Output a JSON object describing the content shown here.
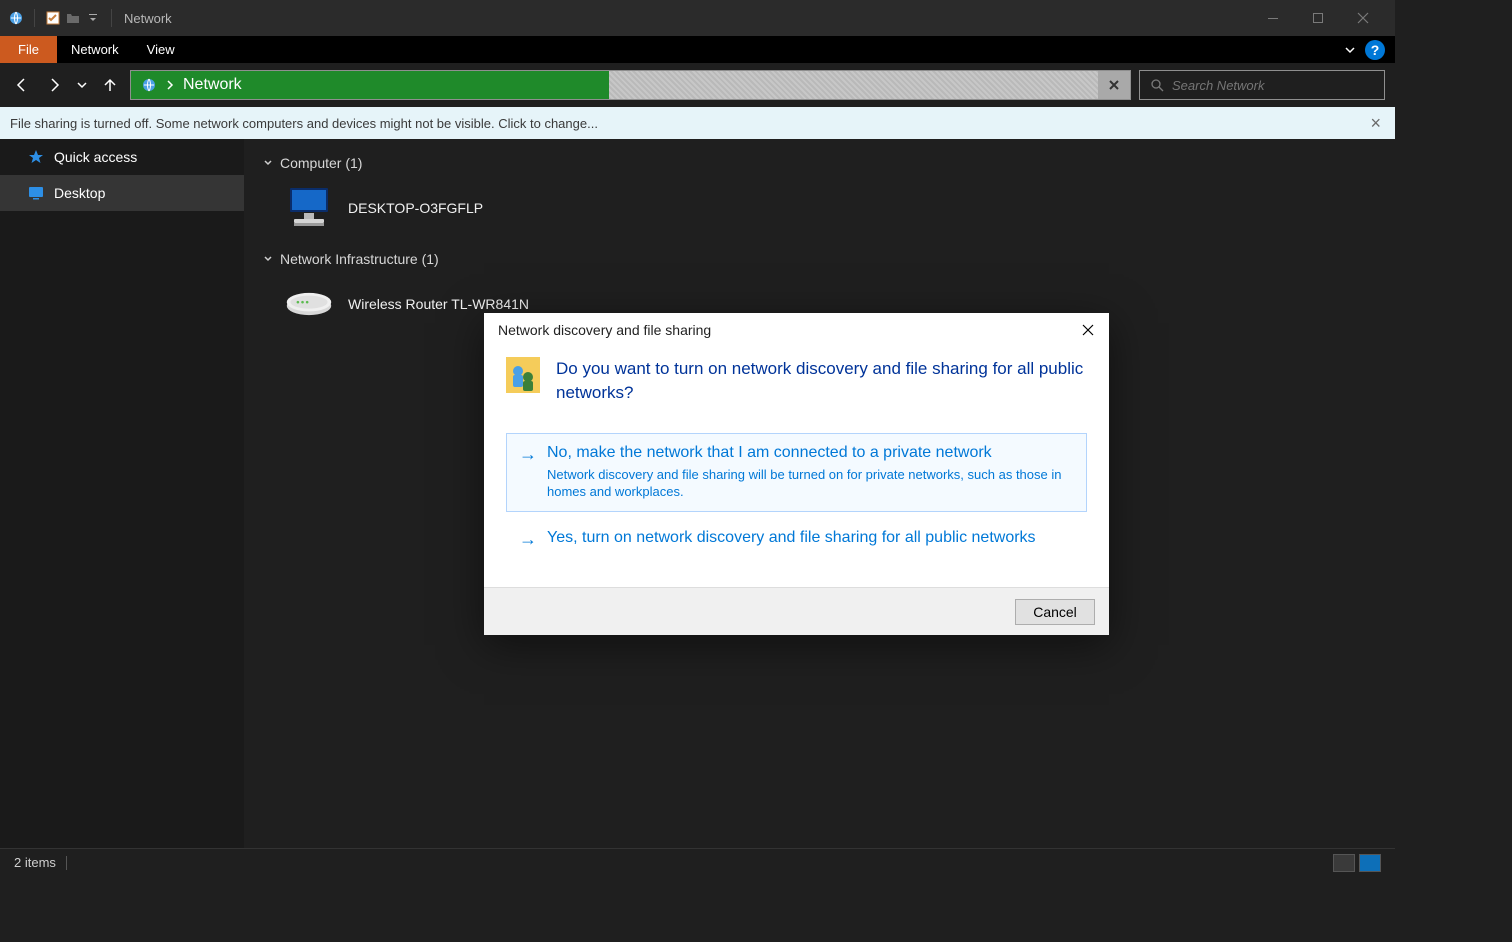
{
  "titlebar": {
    "title": "Network"
  },
  "ribbon": {
    "file": "File",
    "tabs": [
      "Network",
      "View"
    ]
  },
  "address": {
    "crumb": "Network"
  },
  "search": {
    "placeholder": "Search Network"
  },
  "infobar": {
    "message": "File sharing is turned off. Some network computers and devices might not be visible. Click to change..."
  },
  "sidebar": {
    "items": [
      {
        "label": "Quick access"
      },
      {
        "label": "Desktop"
      }
    ]
  },
  "content": {
    "groups": [
      {
        "header": "Computer (1)",
        "entries": [
          {
            "label": "DESKTOP-O3FGFLP"
          }
        ]
      },
      {
        "header": "Network Infrastructure (1)",
        "entries": [
          {
            "label": "Wireless Router TL-WR841N"
          }
        ]
      }
    ]
  },
  "statusbar": {
    "count": "2 items"
  },
  "dialog": {
    "title": "Network discovery and file sharing",
    "heading": "Do you want to turn on network discovery and file sharing for all public networks?",
    "options": [
      {
        "title": "No, make the network that I am connected to a private network",
        "desc": "Network discovery and file sharing will be turned on for private networks, such as those in homes and workplaces."
      },
      {
        "title": "Yes, turn on network discovery and file sharing for all public networks",
        "desc": ""
      }
    ],
    "cancel": "Cancel"
  }
}
